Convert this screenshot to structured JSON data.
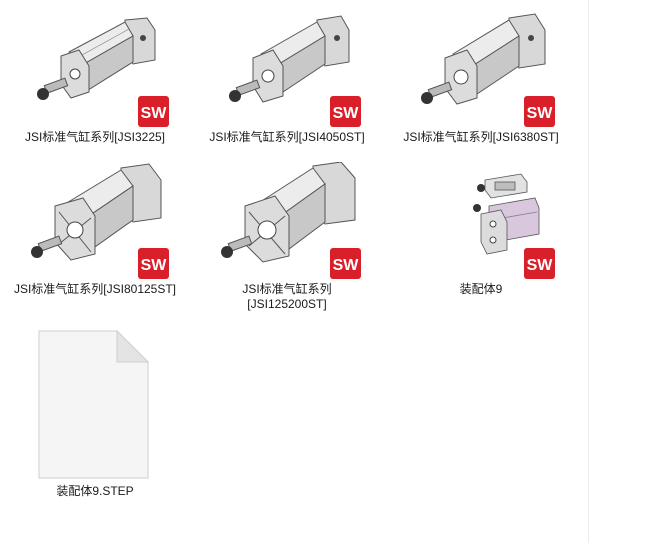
{
  "files": [
    {
      "name": "JSI标准气缸系列[JSI3225]",
      "type": "solidworks-part",
      "icon": "cylinder-part-thumbnail"
    },
    {
      "name": "JSI标准气缸系列[JSI4050ST]",
      "type": "solidworks-part",
      "icon": "cylinder-part-thumbnail"
    },
    {
      "name": "JSI标准气缸系列[JSI6380ST]",
      "type": "solidworks-part",
      "icon": "cylinder-part-thumbnail"
    },
    {
      "name": "JSI标准气缸系列[JSI80125ST]",
      "type": "solidworks-part",
      "icon": "cylinder-part-thumbnail"
    },
    {
      "name_line1": "JSI标准气缸系列",
      "name_line2": "[JSI125200ST]",
      "type": "solidworks-part",
      "icon": "cylinder-part-thumbnail"
    },
    {
      "name": "装配体9",
      "type": "solidworks-assembly",
      "icon": "assembly-thumbnail"
    },
    {
      "name": "装配体9.STEP",
      "type": "step-file",
      "icon": "blank-document-icon"
    }
  ],
  "badge": {
    "letters": "SW",
    "icon": "solidworks-badge-icon",
    "color": "#d9202a"
  }
}
